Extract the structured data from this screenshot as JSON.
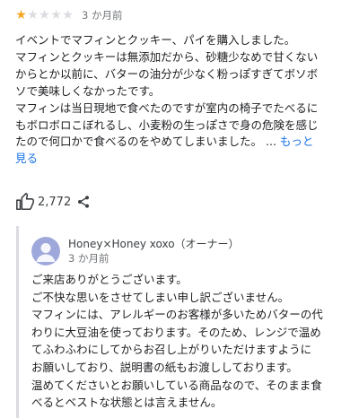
{
  "review": {
    "rating": 1,
    "rating_max": 5,
    "date": "3 か月前",
    "lines": [
      "イベントでマフィンとクッキー、パイを購入しました。",
      "マフィンとクッキーは無添加だから、砂糖少なめで甘くない",
      "からとか以前に、バターの油分が少なく粉っぽすぎてボソボ",
      "ソで美味しくなかったです。",
      "マフィンは当日現地で食べたのですが室内の椅子でたべるに",
      "もボロボロこぼれるし、小麦粉の生っぽさで身の危険を感じ",
      "たので何口かで食べるのをやめてしまいました。"
    ],
    "ellipsis": "...",
    "more_label_part1": "もっと",
    "more_label_part2": "見る"
  },
  "reactions": {
    "like_icon": "thumbs-up-icon",
    "like_count": "2,772",
    "share_icon": "share-icon"
  },
  "owner_reply": {
    "name": "Honey×Honey xoxo（オーナー）",
    "date": "3 か月前",
    "avatar_color": "#9fa8da",
    "lines": [
      "ご来店ありがとうございます。",
      "ご不快な思いをさせてしまい申し訳ございません。",
      "マフィンには、アレルギーのお客様が多いためバターの代",
      "わりに大豆油を使っております。そのため、レンジで温め",
      "てふわふわにしてからお召し上がりいただけますように",
      "お願いしており、説明書の紙もお渡ししております。",
      "温めてくださいとお願いしている商品なので、そのまま食",
      "べるとベストな状態とは言えません。"
    ]
  },
  "colors": {
    "star_filled": "#f5a623",
    "star_empty": "#dadce0",
    "link": "#1a73e8",
    "reply_border": "#dadce0"
  }
}
